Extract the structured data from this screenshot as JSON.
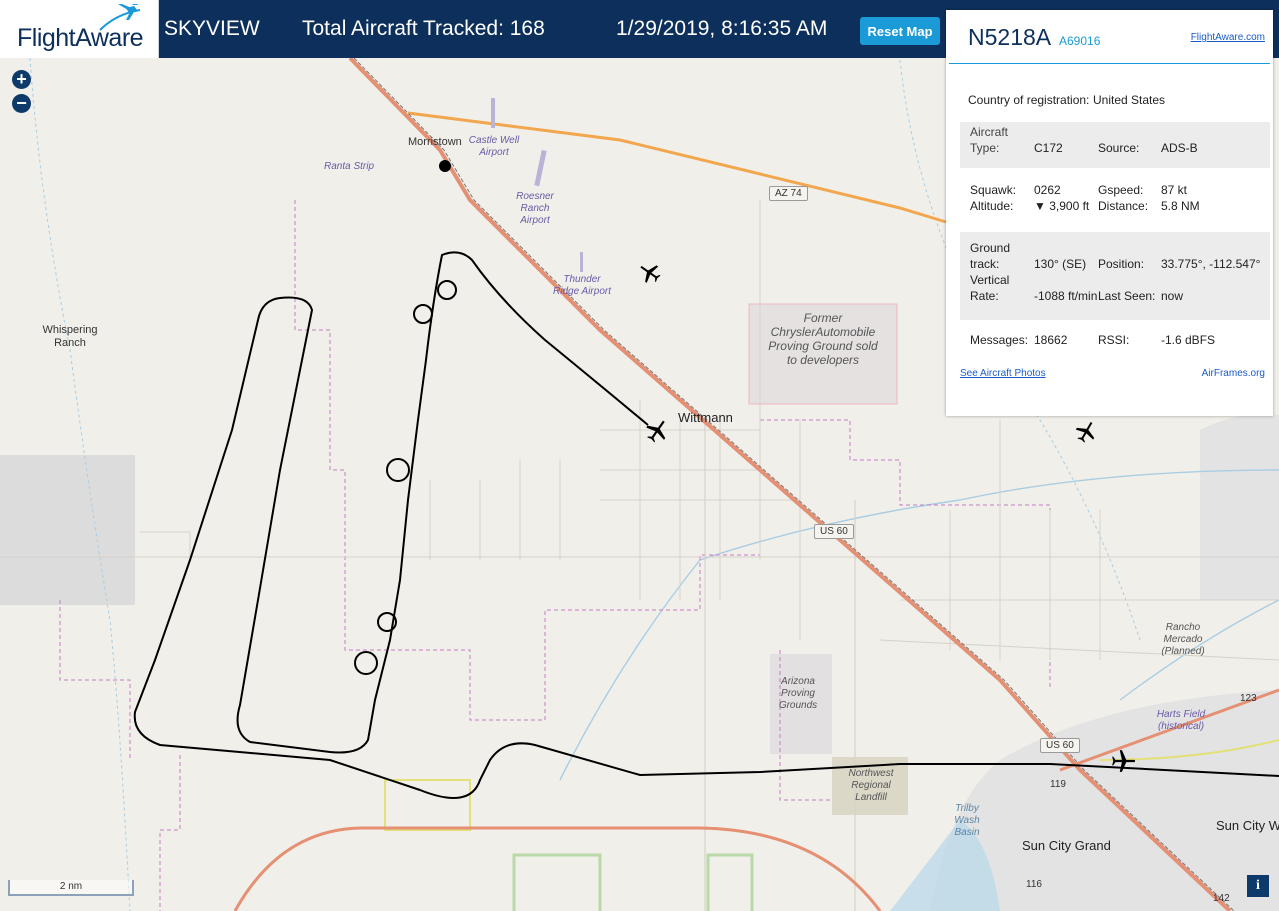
{
  "header": {
    "logo_text": "FlightAware",
    "app_name": "SKYVIEW",
    "aircraft_tracked": "Total Aircraft Tracked: 168",
    "datetime": "1/29/2019, 8:16:35 AM",
    "reset_button": "Reset Map"
  },
  "map": {
    "zoom_in": "+",
    "zoom_out": "−",
    "scale_label": "2 nm",
    "info_button": "i",
    "towns": [
      "Morristown",
      "Wittmann",
      "Sun City Grand",
      "Sun City W"
    ],
    "places": [
      "Whispering Ranch"
    ],
    "airports": [
      "Ranta Strip",
      "Castle Well Airport",
      "Roesner Ranch Airport",
      "Thunder Ridge Airport",
      "Harts Field (historical)"
    ],
    "areas": [
      "Former ChryslerAutomobile Proving Ground sold to developers",
      "Arizona Proving Grounds",
      "Northwest Regional Landfill",
      "Rancho Mercado (Planned)",
      "Trilby Wash Basin"
    ],
    "road_shields": [
      "AZ 74",
      "US 60",
      "US 60"
    ],
    "road_numbers": [
      "119",
      "116",
      "142",
      "123"
    ]
  },
  "panel": {
    "registration": "N5218A",
    "hex_code": "A69016",
    "flightaware_link": "FlightAware.com",
    "country_label": "Country of registration:",
    "country_value": "United States",
    "aircraft_type_label": "Aircraft Type:",
    "aircraft_type_value": "C172",
    "source_label": "Source:",
    "source_value": "ADS-B",
    "squawk_label": "Squawk:",
    "squawk_value": "0262",
    "gspeed_label": "Gspeed:",
    "gspeed_value": "87 kt",
    "altitude_label": "Altitude:",
    "altitude_value": "▼ 3,900 ft",
    "distance_label": "Distance:",
    "distance_value": "5.8 NM",
    "ground_track_label": "Ground track:",
    "ground_track_value": "130° (SE)",
    "position_label": "Position:",
    "position_value": "33.775°, -112.547°",
    "vertical_rate_label": "Vertical Rate:",
    "vertical_rate_value": "-1088 ft/min",
    "last_seen_label": "Last Seen:",
    "last_seen_value": "now",
    "messages_label": "Messages:",
    "messages_value": "18662",
    "rssi_label": "RSSI:",
    "rssi_value": "-1.6 dBFS",
    "photos_link": "See Aircraft Photos",
    "airframes_link": "AirFrames.org"
  },
  "colors": {
    "header_bg": "#0d2f5b",
    "accent": "#1a9ad6",
    "map_bg": "#f1efe9",
    "major_road": "#e58f73",
    "trunk_road": "#f2a64e",
    "water": "#a9cde3",
    "boundary": "#c77ec8"
  }
}
